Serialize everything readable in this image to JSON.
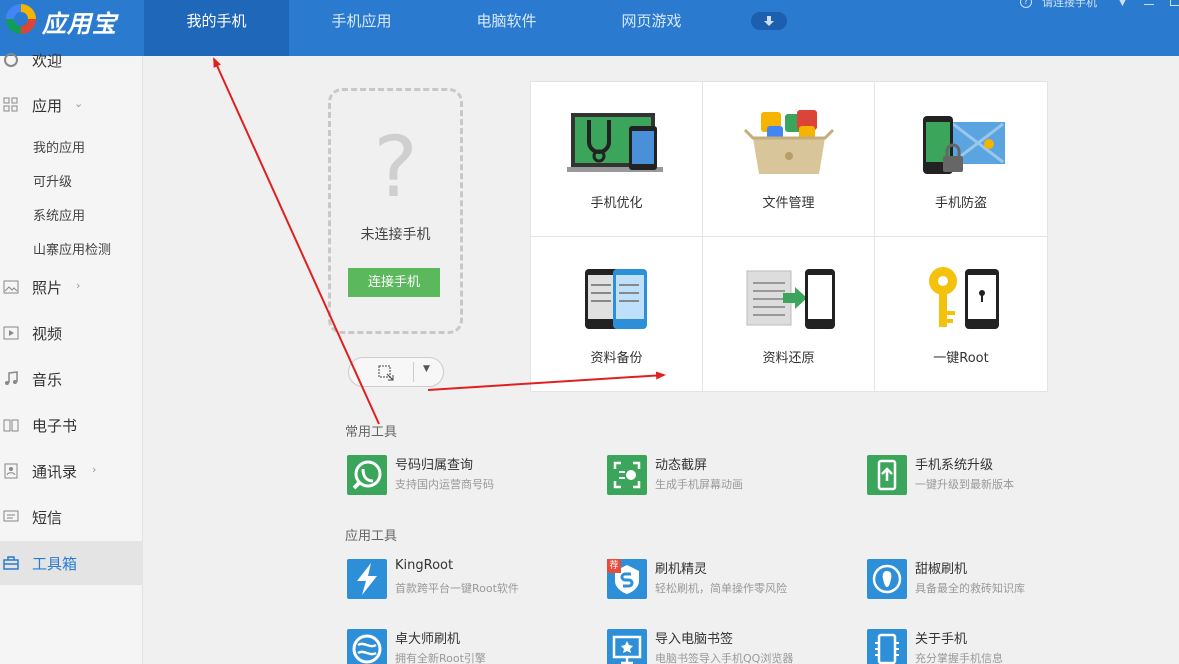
{
  "app": {
    "brand": "应用宝"
  },
  "nav": {
    "tabs": [
      "我的手机",
      "手机应用",
      "电脑软件",
      "网页游戏"
    ],
    "active": 0
  },
  "titlebar": {
    "status": "请连接手机"
  },
  "sidebar": {
    "items": [
      {
        "label": "欢迎",
        "icon": "welcome-icon"
      },
      {
        "label": "应用",
        "icon": "apps-grid-icon"
      },
      {
        "label": "照片",
        "icon": "photo-icon"
      },
      {
        "label": "视频",
        "icon": "video-icon"
      },
      {
        "label": "音乐",
        "icon": "music-icon"
      },
      {
        "label": "电子书",
        "icon": "ebook-icon"
      },
      {
        "label": "通讯录",
        "icon": "contacts-icon"
      },
      {
        "label": "短信",
        "icon": "sms-icon"
      },
      {
        "label": "工具箱",
        "icon": "toolbox-icon"
      }
    ],
    "subitems": [
      "我的应用",
      "可升级",
      "系统应用",
      "山寨应用检测"
    ]
  },
  "phone": {
    "question": "?",
    "status": "未连接手机",
    "connect_label": "连接手机"
  },
  "features": [
    "手机优化",
    "文件管理",
    "手机防盗",
    "资料备份",
    "资料还原",
    "一键Root"
  ],
  "common_tools": {
    "title": "常用工具",
    "items": [
      {
        "name": "号码归属查询",
        "desc": "支持国内运营商号码",
        "color": "#3aa55b"
      },
      {
        "name": "动态截屏",
        "desc": "生成手机屏幕动画",
        "color": "#3aa55b"
      },
      {
        "name": "手机系统升级",
        "desc": "一键升级到最新版本",
        "color": "#3aa55b"
      }
    ]
  },
  "app_tools": {
    "title": "应用工具",
    "items": [
      {
        "name": "KingRoot",
        "desc": "首款跨平台一键Root软件",
        "color": "#2d8fd8"
      },
      {
        "name": "刷机精灵",
        "desc": "轻松刷机，简单操作零风险",
        "color": "#2d8fd8",
        "tag": "荐"
      },
      {
        "name": "甜椒刷机",
        "desc": "具备最全的救砖知识库",
        "color": "#2d8fd8"
      },
      {
        "name": "卓大师刷机",
        "desc": "拥有全新Root引擎",
        "color": "#2d8fd8"
      },
      {
        "name": "导入电脑书签",
        "desc": "电脑书签导入手机QQ浏览器",
        "color": "#2d8fd8"
      },
      {
        "name": "关于手机",
        "desc": "充分掌握手机信息",
        "color": "#2d8fd8"
      }
    ]
  },
  "colors": {
    "brand_blue": "#2a7bd0",
    "active_tab": "#1f67b8",
    "connect_green": "#5cb85c",
    "annotation_red": "#e02020"
  }
}
